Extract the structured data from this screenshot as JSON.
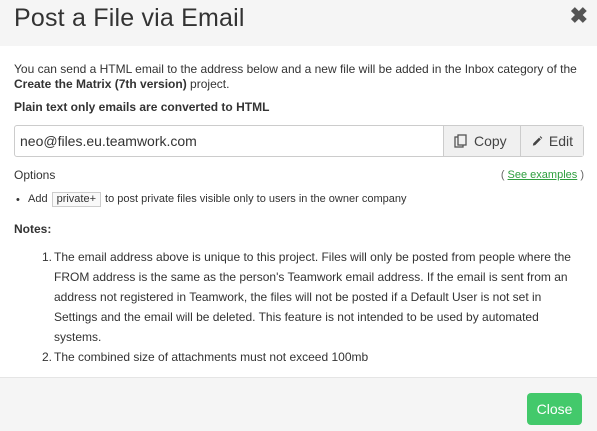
{
  "header": {
    "title": "Post a File via Email",
    "close_glyph": "✖"
  },
  "intro": {
    "text_before": "You can send a HTML email to the address below and a new file will be added in the Inbox category of the ",
    "project_name": "Create the Matrix (7th version)",
    "text_after": " project."
  },
  "plain_text_note": "Plain text only emails are converted to HTML",
  "email": {
    "value": "neo@files.eu.teamwork.com",
    "copy_label": "Copy",
    "edit_label": "Edit"
  },
  "options": {
    "label": "Options",
    "see_examples_open": "( ",
    "see_examples_link": "See examples",
    "see_examples_close": " )",
    "bullet_prefix": "Add",
    "bullet_code": "private+",
    "bullet_suffix": "to post private files visible only to users in the owner company"
  },
  "notes": {
    "label": "Notes:",
    "items": [
      {
        "num": "1.",
        "text": "The email address above is unique to this project. Files will only be posted from people where the FROM address is the same as the person's Teamwork email address. If the email is sent from an address not registered in Teamwork, the files will not be posted if a Default User is not set in Settings and the email will be deleted. This feature is not intended to be used by automated systems."
      },
      {
        "num": "2.",
        "text": "The combined size of attachments must not exceed 100mb"
      }
    ]
  },
  "footer": {
    "close_label": "Close"
  },
  "colors": {
    "primary_button": "#43c96b",
    "link": "#2e9e3e"
  },
  "icons": {
    "copy": "copy-icon",
    "edit": "pencil-icon"
  }
}
